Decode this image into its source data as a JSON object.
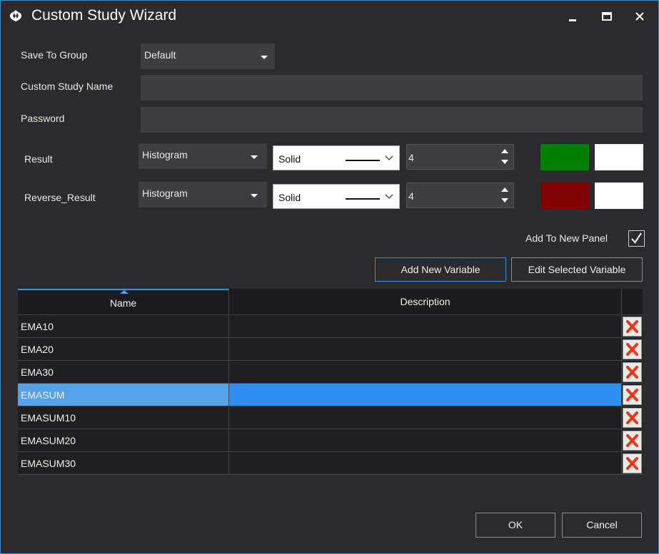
{
  "window": {
    "title": "Custom Study Wizard",
    "accent_color": "#3e8fd6",
    "icons": {
      "app": "app-logo-icon",
      "minimize": "minimize-icon",
      "maximize": "maximize-icon",
      "close": "close-icon"
    }
  },
  "form": {
    "save_to_group": {
      "label": "Save To Group",
      "value": "Default"
    },
    "custom_study_name": {
      "label": "Custom Study Name",
      "value": ""
    },
    "password": {
      "label": "Password",
      "value": ""
    }
  },
  "plots": [
    {
      "label": "Result",
      "type": "Histogram",
      "line_style": "Solid",
      "width": "4",
      "color1": "#007f00",
      "color2": "#ffffff"
    },
    {
      "label": "Reverse_Result",
      "type": "Histogram",
      "line_style": "Solid",
      "width": "4",
      "color1": "#7f0000",
      "color2": "#ffffff"
    }
  ],
  "add_to_new_panel": {
    "label": "Add To New Panel",
    "checked": true
  },
  "buttons": {
    "add_new_variable": "Add New Variable",
    "edit_selected_variable": "Edit Selected Variable",
    "ok": "OK",
    "cancel": "Cancel"
  },
  "variables_table": {
    "columns": [
      "Name",
      "Description"
    ],
    "rows": [
      {
        "name": "EMA10",
        "description": ""
      },
      {
        "name": "EMA20",
        "description": ""
      },
      {
        "name": "EMA30",
        "description": ""
      },
      {
        "name": "EMASUM",
        "description": "",
        "selected": true
      },
      {
        "name": "EMASUM10",
        "description": ""
      },
      {
        "name": "EMASUM20",
        "description": ""
      },
      {
        "name": "EMASUM30",
        "description": ""
      }
    ],
    "delete_icon": "delete-x-icon"
  }
}
